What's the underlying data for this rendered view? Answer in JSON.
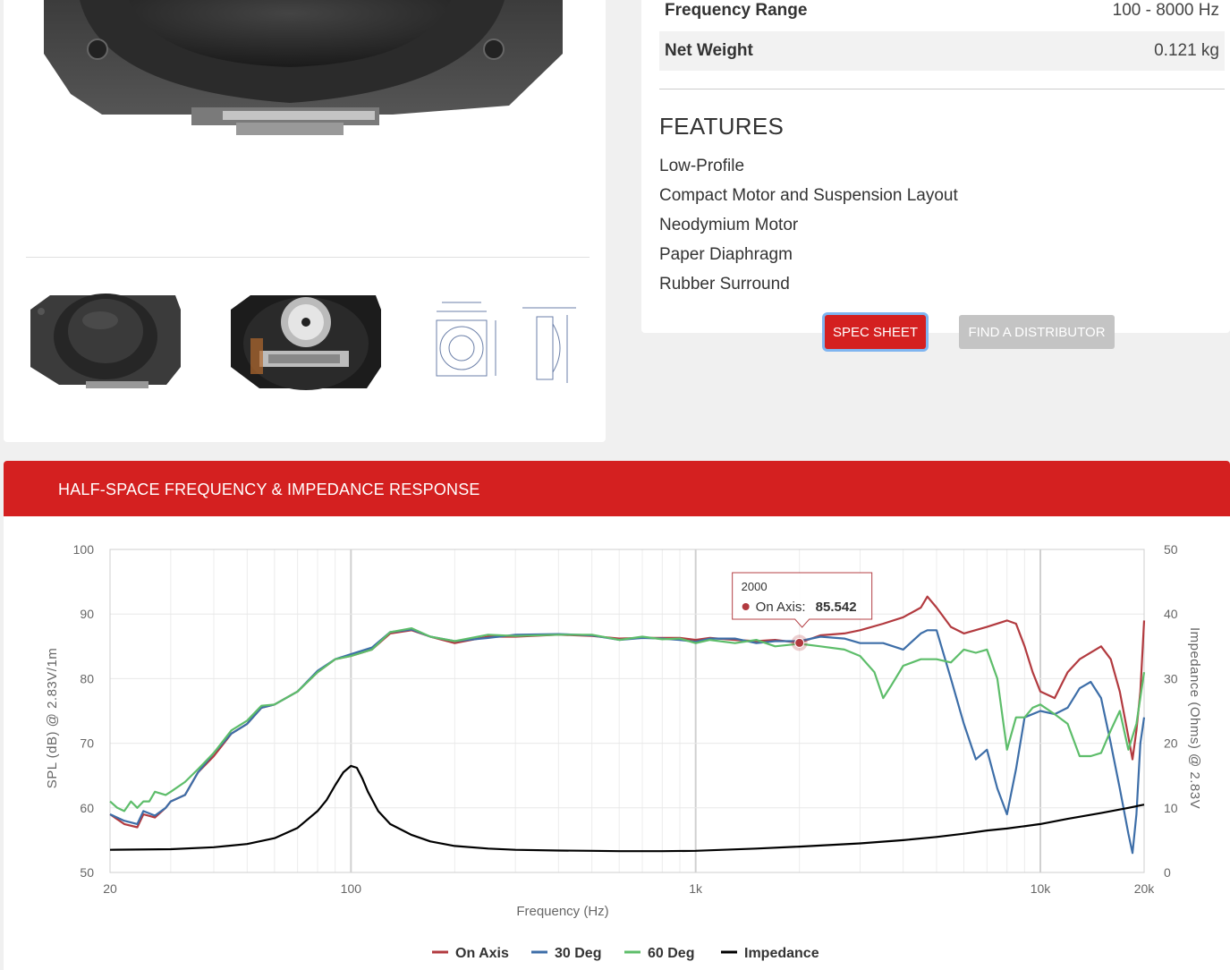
{
  "product": {
    "images": [
      {
        "name": "front-view",
        "alt": ""
      },
      {
        "name": "rear-view",
        "alt": ""
      },
      {
        "name": "dimension-drawing",
        "alt": ""
      }
    ]
  },
  "specs": [
    {
      "label": "Frequency Range",
      "value": "100 - 8000 Hz"
    },
    {
      "label": "Net Weight",
      "value": "0.121 kg"
    }
  ],
  "features": {
    "title": "FEATURES",
    "items": [
      "Low-Profile",
      "Compact Motor and Suspension Layout",
      "Neodymium Motor",
      "Paper Diaphragm",
      "Rubber Surround"
    ]
  },
  "buttons": {
    "spec_sheet": "SPEC SHEET",
    "find_distributor": "FIND A DISTRIBUTOR"
  },
  "colors": {
    "brand_red": "#d42020",
    "on_axis": "#b23a3f",
    "deg30": "#3d6ea8",
    "deg60": "#5dbd6a",
    "impedance": "#000000"
  },
  "chart_section": {
    "title": "HALF-SPACE FREQUENCY & IMPEDANCE RESPONSE"
  },
  "chart_data": {
    "type": "line",
    "xlabel": "Frequency (Hz)",
    "ylabel": "SPL (dB) @ 2.83V/1m",
    "y2label": "Impedance (Ohms) @ 2.83V",
    "xscale": "log",
    "xlim": [
      20,
      20000
    ],
    "ylim": [
      50,
      100
    ],
    "y2lim": [
      0,
      50
    ],
    "x_ticks": [
      {
        "value": 20,
        "label": "20"
      },
      {
        "value": 100,
        "label": "100"
      },
      {
        "value": 1000,
        "label": "1k"
      },
      {
        "value": 10000,
        "label": "10k"
      },
      {
        "value": 20000,
        "label": "20k"
      }
    ],
    "y_ticks": [
      50,
      60,
      70,
      80,
      90,
      100
    ],
    "y2_ticks": [
      0,
      10,
      20,
      30,
      40,
      50
    ],
    "grid": true,
    "legend": "bottom-center",
    "tooltip": {
      "x": 2000,
      "series": "On Axis",
      "label": "On Axis:",
      "value": "85.542",
      "header": "2000"
    },
    "series": [
      {
        "name": "On Axis",
        "axis": "y",
        "color": "#b23a3f",
        "x": [
          20,
          22,
          24,
          25,
          27,
          29,
          30,
          33,
          36,
          40,
          45,
          50,
          55,
          60,
          70,
          80,
          90,
          100,
          115,
          130,
          150,
          170,
          200,
          250,
          300,
          400,
          500,
          600,
          700,
          800,
          900,
          1000,
          1100,
          1300,
          1500,
          1700,
          2000,
          2300,
          2700,
          3000,
          3500,
          4000,
          4500,
          4700,
          5000,
          5500,
          6000,
          7000,
          8000,
          8500,
          9000,
          9500,
          10000,
          11000,
          12000,
          13000,
          15000,
          16000,
          17000,
          18000,
          18500,
          19000,
          19500,
          20000
        ],
        "y": [
          59,
          57.5,
          57,
          59,
          58.5,
          60,
          61,
          62,
          65.5,
          68,
          71.5,
          73,
          75.5,
          76,
          78,
          81,
          83,
          83.5,
          84.5,
          87,
          87.5,
          86.5,
          85.5,
          86.5,
          86.5,
          86.8,
          86.6,
          86.2,
          86.3,
          86.3,
          86.3,
          86,
          86.3,
          86,
          85.8,
          86,
          85.542,
          86.7,
          87,
          87.5,
          88.5,
          89.5,
          91,
          92.7,
          91,
          88,
          87,
          88,
          89,
          88.5,
          85,
          81,
          78,
          77,
          81,
          83,
          85,
          83,
          78,
          71,
          67.5,
          72,
          78,
          89
        ]
      },
      {
        "name": "30 Deg",
        "axis": "y",
        "color": "#3d6ea8",
        "x": [
          20,
          22,
          24,
          25,
          27,
          29,
          30,
          33,
          36,
          40,
          45,
          50,
          55,
          60,
          70,
          80,
          90,
          100,
          115,
          130,
          150,
          170,
          200,
          250,
          300,
          400,
          500,
          600,
          700,
          800,
          900,
          1000,
          1100,
          1300,
          1500,
          1700,
          2000,
          2300,
          2700,
          3000,
          3500,
          4000,
          4500,
          4700,
          5000,
          5500,
          6000,
          6500,
          7000,
          7500,
          8000,
          8500,
          9000,
          10000,
          11000,
          12000,
          13000,
          14000,
          15000,
          16000,
          17000,
          18000,
          18500,
          19000,
          19500,
          20000
        ],
        "y": [
          59,
          58,
          57.5,
          59.5,
          58.8,
          60,
          61,
          62,
          65.5,
          68.5,
          71.5,
          73,
          75.5,
          76,
          78,
          81.2,
          83,
          83.8,
          84.8,
          87.2,
          87.6,
          86.5,
          85.8,
          86.3,
          86.8,
          86.9,
          86.7,
          86,
          86.3,
          86.2,
          86,
          85.7,
          86.2,
          86.2,
          85.5,
          85.8,
          85.8,
          86.5,
          86.2,
          85.5,
          85.5,
          84.5,
          87,
          87.5,
          87.5,
          80,
          73,
          67.5,
          69,
          63,
          59,
          66,
          74,
          75,
          74.5,
          75.5,
          78.5,
          79.5,
          77,
          70,
          63,
          56,
          53,
          59,
          70,
          74
        ]
      },
      {
        "name": "60 Deg",
        "axis": "y",
        "color": "#5dbd6a",
        "x": [
          20,
          21,
          22,
          23,
          24,
          25,
          26,
          27,
          29,
          30,
          33,
          36,
          40,
          45,
          50,
          55,
          60,
          70,
          80,
          90,
          100,
          115,
          130,
          150,
          170,
          200,
          250,
          300,
          400,
          500,
          600,
          700,
          800,
          900,
          1000,
          1100,
          1300,
          1500,
          1700,
          2000,
          2300,
          2700,
          3000,
          3300,
          3500,
          3700,
          4000,
          4500,
          5000,
          5500,
          6000,
          6500,
          7000,
          7500,
          8000,
          8500,
          9000,
          9500,
          10000,
          11000,
          12000,
          13000,
          14000,
          15000,
          16000,
          17000,
          18000,
          19000,
          20000
        ],
        "y": [
          61,
          60,
          59.5,
          61,
          60,
          61,
          61,
          62.5,
          62,
          62.5,
          64,
          66,
          68.5,
          72,
          73.5,
          75.8,
          76,
          78,
          81,
          83,
          83.5,
          84.5,
          87.2,
          87.8,
          86.5,
          85.8,
          86.8,
          86.6,
          86.8,
          86.8,
          86,
          86.5,
          86.1,
          86.2,
          85.5,
          86,
          85.5,
          86,
          85,
          85.4,
          85,
          84.5,
          83.5,
          81,
          77,
          79,
          82,
          83,
          83,
          82.5,
          84.5,
          84,
          84.5,
          80,
          69,
          74,
          74,
          75.5,
          76,
          74.5,
          73,
          68,
          68,
          68.5,
          72,
          75,
          69,
          73,
          81
        ]
      },
      {
        "name": "Impedance",
        "axis": "y2",
        "color": "#000000",
        "x": [
          20,
          30,
          40,
          50,
          60,
          70,
          80,
          85,
          90,
          95,
          100,
          104,
          108,
          112,
          120,
          130,
          150,
          170,
          200,
          250,
          300,
          400,
          500,
          600,
          800,
          1000,
          1500,
          2000,
          3000,
          4000,
          5000,
          6000,
          7000,
          8000,
          10000,
          12000,
          15000,
          18000,
          20000
        ],
        "y": [
          3.5,
          3.6,
          3.9,
          4.4,
          5.3,
          6.9,
          9.5,
          11.2,
          13.5,
          15.5,
          16.5,
          16.2,
          14.5,
          12.5,
          9.5,
          7.5,
          5.8,
          4.8,
          4.1,
          3.7,
          3.5,
          3.4,
          3.35,
          3.3,
          3.3,
          3.35,
          3.7,
          4,
          4.5,
          5,
          5.5,
          6,
          6.5,
          6.8,
          7.5,
          8.3,
          9.2,
          10,
          10.5
        ]
      }
    ]
  }
}
